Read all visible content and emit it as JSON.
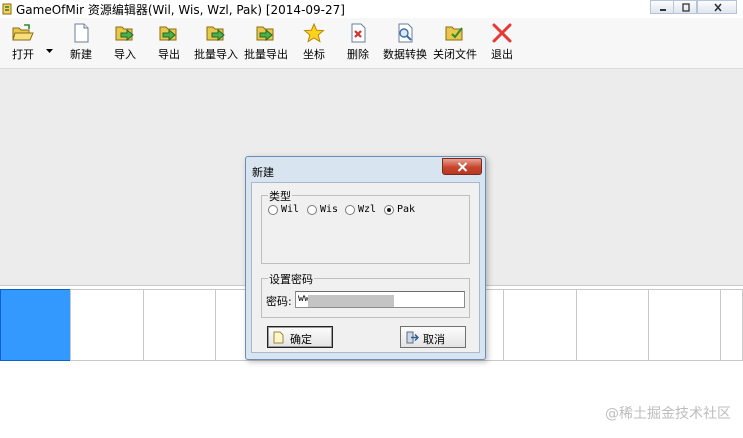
{
  "window": {
    "title": "GameOfMir 资源编辑器(Wil, Wis, Wzl, Pak) [2014-09-27]"
  },
  "toolbar": {
    "items": [
      {
        "label": "打开",
        "icon": "folder-open-icon"
      },
      {
        "label": "新建",
        "icon": "new-file-icon"
      },
      {
        "label": "导入",
        "icon": "import-icon"
      },
      {
        "label": "导出",
        "icon": "export-icon"
      },
      {
        "label": "批量导入",
        "icon": "batch-import-icon"
      },
      {
        "label": "批量导出",
        "icon": "batch-export-icon"
      },
      {
        "label": "坐标",
        "icon": "star-icon"
      },
      {
        "label": "删除",
        "icon": "delete-icon"
      },
      {
        "label": "数据转换",
        "icon": "convert-icon"
      },
      {
        "label": "关闭文件",
        "icon": "close-file-icon"
      },
      {
        "label": "退出",
        "icon": "exit-icon"
      }
    ]
  },
  "dialog": {
    "title": "新建",
    "type_group": {
      "label": "类型",
      "options": [
        "Wil",
        "Wis",
        "Wzl",
        "Pak"
      ],
      "selected": "Pak"
    },
    "password_group": {
      "label": "设置密码",
      "field_label": "密码:",
      "value": "ww"
    },
    "ok_label": "确定",
    "cancel_label": "取消"
  },
  "watermark": "@稀土掘金技术社区",
  "colors": {
    "selection": "#3399ff",
    "dialog_frame": "#d9e4f1",
    "close_button": "#c7462e"
  }
}
